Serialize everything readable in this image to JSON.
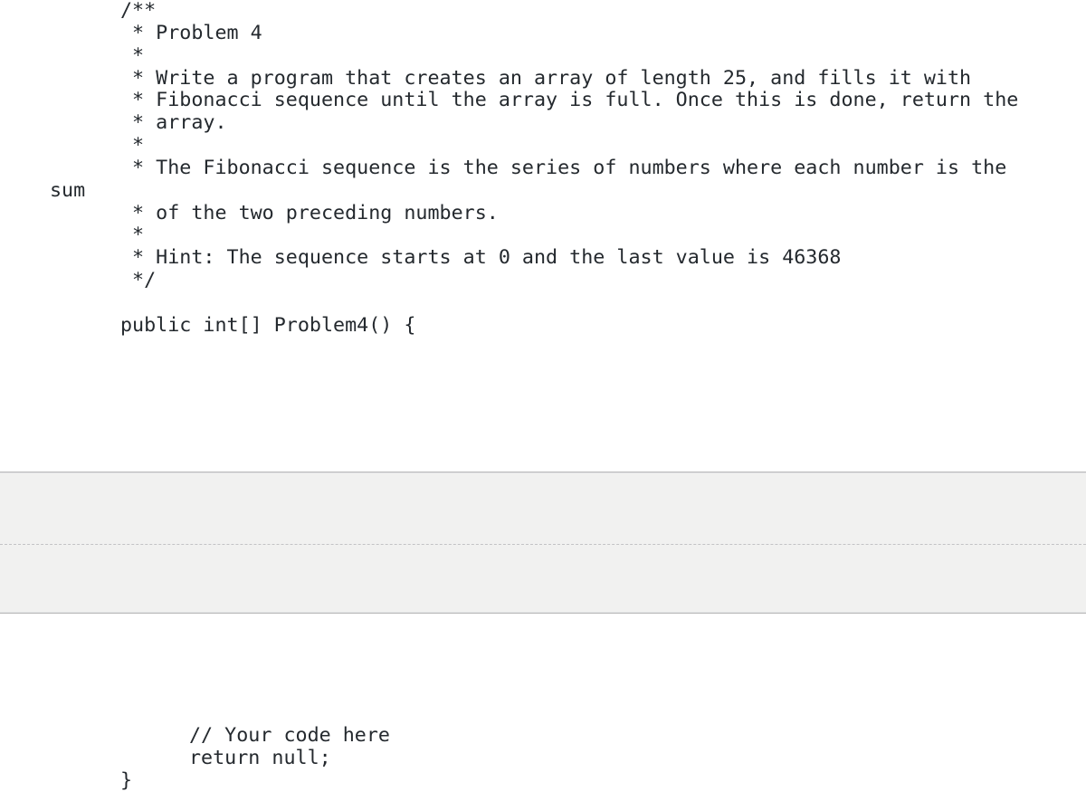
{
  "document": {
    "language": "java",
    "background_color": "#ffffff",
    "text_color": "#24292e"
  },
  "code_top": {
    "lines": [
      {
        "text": "/**",
        "indent": "indent-1"
      },
      {
        "text": " * Problem 4",
        "indent": "indent-1"
      },
      {
        "text": " *",
        "indent": "indent-1"
      },
      {
        "text": " * Write a program that creates an array of length 25, and fills it with",
        "indent": "indent-1"
      },
      {
        "text": " * Fibonacci sequence until the array is full. Once this is done, return the",
        "indent": "indent-1"
      },
      {
        "text": " * array.",
        "indent": "indent-1"
      },
      {
        "text": " *",
        "indent": "indent-1"
      },
      {
        "text": " * The Fibonacci sequence is the series of numbers where each number is the",
        "indent": "indent-1"
      },
      {
        "text": "sum",
        "indent": "wrap-overflow"
      },
      {
        "text": " * of the two preceding numbers.",
        "indent": "indent-1"
      },
      {
        "text": " *",
        "indent": "indent-1"
      },
      {
        "text": " * Hint: The sequence starts at 0 and the last value is 46368",
        "indent": "indent-1"
      },
      {
        "text": " */",
        "indent": "indent-1"
      },
      {
        "text": "",
        "indent": "indent-1"
      },
      {
        "text": "public int[] Problem4() {",
        "indent": "indent-1"
      }
    ]
  },
  "panel": {
    "background_color": "#f1f1f0",
    "border_color": "#b9b9b9",
    "divider_color": "#c3c3c5",
    "upper_section_label": "",
    "lower_section_label": ""
  },
  "code_bottom": {
    "lines": [
      {
        "text": "// Your code here",
        "indent": "indent-2"
      },
      {
        "text": "return null;",
        "indent": "indent-2"
      },
      {
        "text": "}",
        "indent": "indent-1"
      }
    ]
  }
}
